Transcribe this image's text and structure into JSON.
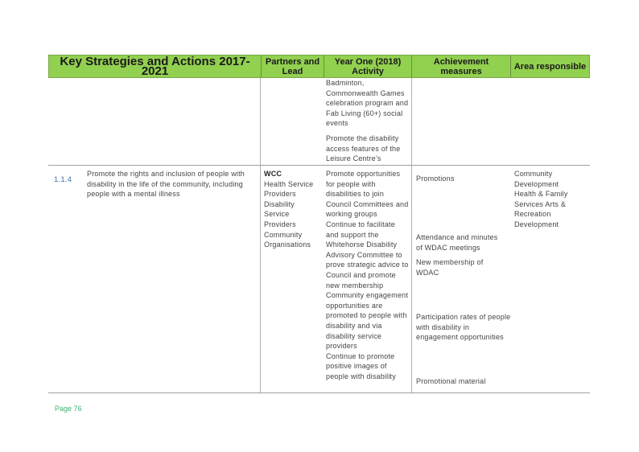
{
  "header": {
    "col1": "Key Strategies and Actions 2017-2021",
    "col2": "Partners and Lead",
    "col3": "Year One (2018) Activity",
    "col4": "Achievement measures",
    "col5": "Area responsible"
  },
  "continued_row": {
    "activity": [
      "Badminton, Commonwealth Games celebration program and Fab Living (60+) social events",
      "Promote the disability access features of the Leisure Centre’s"
    ]
  },
  "row_114": {
    "number": "1.1.4",
    "strategy": "Promote the rights and inclusion of people with disability in the life of the community, including people with a mental illness",
    "lead": "WCC",
    "partners": "Health Service Providers Disability Service Providers Community Organisations",
    "activity_1": "Promote opportunities for people with disabilities to join Council Committees and working groups",
    "activity_2": "Continue to facilitate and support the Whitehorse Disability Advisory Committee to prove strategic advice to Council and promote new membership",
    "activity_3": "Community engagement opportunities are promoted to people with disability and via disability service providers",
    "activity_4": "Continue to promote positive images of people with disability",
    "measure_1": "Promotions",
    "measure_2": "Attendance and minutes of WDAC meetings",
    "measure_3": "New membership of WDAC",
    "measure_4": "Participation rates of people with disability in engagement opportunities",
    "measure_5": "Promotional material",
    "area": "Community Development Health & Family Services Arts & Recreation Development"
  },
  "footer": {
    "page": "Page 76"
  },
  "colors": {
    "header_green": "#92d050",
    "page_number": "#3cb371",
    "number_blue": "#3c6fa8"
  }
}
